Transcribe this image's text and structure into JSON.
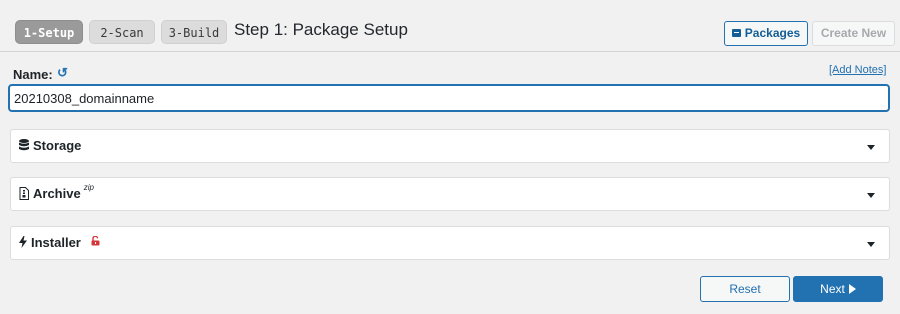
{
  "steps": [
    {
      "label": "1-Setup",
      "active": true
    },
    {
      "label": "2-Scan",
      "active": false
    },
    {
      "label": "3-Build",
      "active": false
    }
  ],
  "header": {
    "title": "Step 1: Package Setup",
    "packages_label": "Packages",
    "create_new_label": "Create New"
  },
  "name_field": {
    "label": "Name:",
    "value": "20210308_domainname",
    "add_notes_label": "[Add Notes]"
  },
  "panels": [
    {
      "title": "Storage",
      "icon": "database-icon"
    },
    {
      "title": "Archive",
      "superscript": "zip",
      "icon": "file-archive-icon"
    },
    {
      "title": "Installer",
      "icon": "bolt-icon",
      "badge_icon": "unlock-icon"
    }
  ],
  "footer": {
    "reset_label": "Reset",
    "next_label": "Next"
  },
  "colors": {
    "accent": "#2271b1",
    "active_step": "#9a9a9a",
    "lock_red": "#d63638"
  }
}
